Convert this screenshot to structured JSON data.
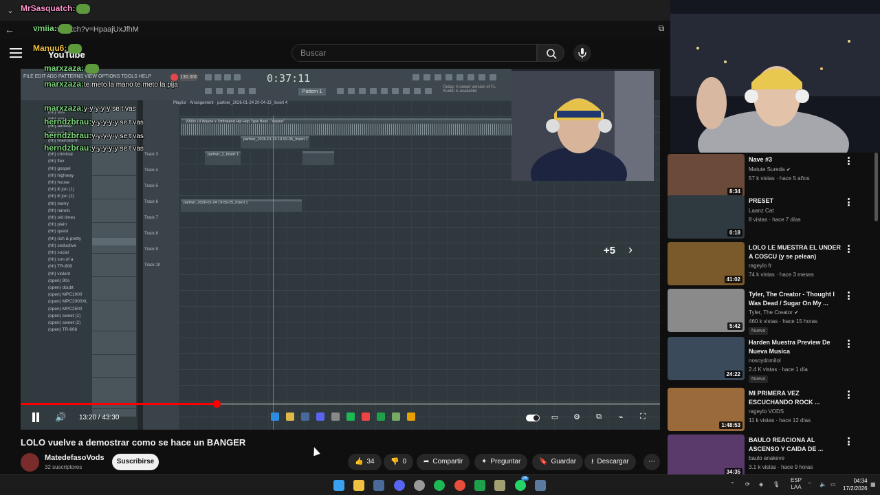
{
  "browser": {
    "url": "be.com/watch?v=HpaajUxJfhM"
  },
  "youtube": {
    "logo_text": "YouTube",
    "search_placeholder": "Buscar"
  },
  "video": {
    "time": "13:20 / 43:30",
    "progress_fraction": 0.3065,
    "overlay_count": "+5"
  },
  "fl": {
    "clock": "0:37:11",
    "tempo": "130.000",
    "pattern": "Pattern 1",
    "menu": "FILE EDIT ADD PATTERNS VIEW OPTIONS TOOLS HELP",
    "news": "Today: A newer version of FL Studio is available!",
    "playlist_title": "Playlist - Arrangement · partner_2026-01-24 20-04-23_Insert 4",
    "main_clip": "2000s Lil Wayne x Timbaland Hip Hop Type Beat - \"wayne\"",
    "clips": [
      "partner_2_Insert 1",
      "partner_2026-01-24 19-59-05_Insert 1",
      "partner_2026-01-24 19-59-25_Insert 1"
    ],
    "browser_items": [
      "(hh) 90s",
      "(hh) acid",
      "(hh) athlese",
      "(hh) believe",
      "(hh) brainstorm",
      "(hh) crew",
      "(hh) criminal",
      "(hh) flex",
      "(hh) gospel",
      "(hh) highway",
      "(hh) house",
      "(hh) lil jon (1)",
      "(hh) lil jon (2)",
      "(hh) merry",
      "(hh) naruto",
      "(hh) old times",
      "(hh) plain",
      "(hh) quest",
      "(hh) rich & pretty",
      "(hh) seductive",
      "(hh) social",
      "(hh) son of a",
      "(hh) TR-808",
      "(hh) violent",
      "(open) 90s",
      "(open) doubt",
      "(open) MPC1000",
      "(open) MPC2000XL",
      "(open) MPC2500",
      "(open) sweet (1)",
      "(open) sweet (2)",
      "(open) TR-808"
    ],
    "track_labels": [
      "Track 3",
      "Track 4",
      "Track 5",
      "Track 6",
      "Track 7",
      "Track 8",
      "Track 9",
      "Track 10"
    ]
  },
  "chat": [
    {
      "user": "MrSasquatch:",
      "msg": ""
    },
    {
      "user": "vmiia:",
      "msg": ""
    },
    {
      "user": "Manuu6:",
      "msg": ""
    },
    {
      "user": "marxzaza:",
      "msg": ""
    },
    {
      "user": "marxzaza:",
      "msg": "te meto la mano te meto la pija"
    },
    {
      "user": "marxzaza:",
      "msg": "y-y-y-y-y se t vas"
    },
    {
      "user": "herndzbrau:",
      "msg": "y-y-y-y-y se t vas"
    },
    {
      "user": "herndzbrau:",
      "msg": "y-y-y-y-y se t vas"
    },
    {
      "user": "herndzbrau:",
      "msg": "y-y-y-y-y se t vas"
    }
  ],
  "meta": {
    "title": "LOLO vuelve a demostrar como se hace un BANGER",
    "channel": "MatedefasoVods",
    "subs": "32 suscriptores",
    "subscribe": "Suscribirse",
    "likes": "34",
    "dislikes": "0",
    "share": "Compartir",
    "ask": "Preguntar",
    "save": "Guardar",
    "download": "Descargar"
  },
  "recommended": [
    {
      "title": "Nave #3",
      "channel": "Matute Sureda",
      "stats": "57 k vistas · hace 5 años",
      "duration": "8:34",
      "thumb": "#6b4a3a",
      "is_new": false,
      "verified": true
    },
    {
      "title": "PRESET",
      "channel": "Laanz Cat",
      "stats": "8 vistas · hace 7 días",
      "duration": "0:18",
      "thumb": "#2f3a40",
      "is_new": false,
      "verified": false
    },
    {
      "title": "LOLO LE MUESTRA EL UNDER A COSCU (y se pelean)",
      "channel": "rageylo fr",
      "stats": "74 k vistas · hace 3 meses",
      "duration": "41:02",
      "thumb": "#7a5a2a",
      "is_new": false,
      "verified": false
    },
    {
      "title": "Tyler, The Creator - Thought I Was Dead / Sugar On My ...",
      "channel": "Tyler, The Creator",
      "stats": "460 k vistas · hace 15 horas",
      "duration": "5:42",
      "thumb": "#8a8a8a",
      "is_new": true,
      "verified": true
    },
    {
      "title": "Harden Muestra Preview De Nueva Musica",
      "channel": "nosoydomilol",
      "stats": "2.4 K vistas · hace 1 día",
      "duration": "24:22",
      "thumb": "#3a4a5a",
      "is_new": true,
      "verified": false
    },
    {
      "title": "MI PRIMERA VEZ ESCUCHANDO ROCK ...",
      "channel": "rageylo VODS",
      "stats": "11 k vistas · hace 12 días",
      "duration": "1:48:53",
      "thumb": "#9a6a3a",
      "is_new": false,
      "verified": false
    },
    {
      "title": "BAULO REACIONA AL ASCENSO Y CAIDA DE ...",
      "channel": "baulo anakeve",
      "stats": "3.1 k vistas · hace 9 horas",
      "duration": "34:35",
      "thumb": "#5a3a6a",
      "is_new": false,
      "verified": false
    }
  ],
  "new_badge": "Nuevo",
  "taskbar": {
    "lang": "ESP",
    "lang2": "LAA",
    "time": "04:34",
    "date": "17/2/2026",
    "notif": "25"
  },
  "colors": {
    "accent": "#ff0000",
    "fl_bg": "#2f383d"
  }
}
